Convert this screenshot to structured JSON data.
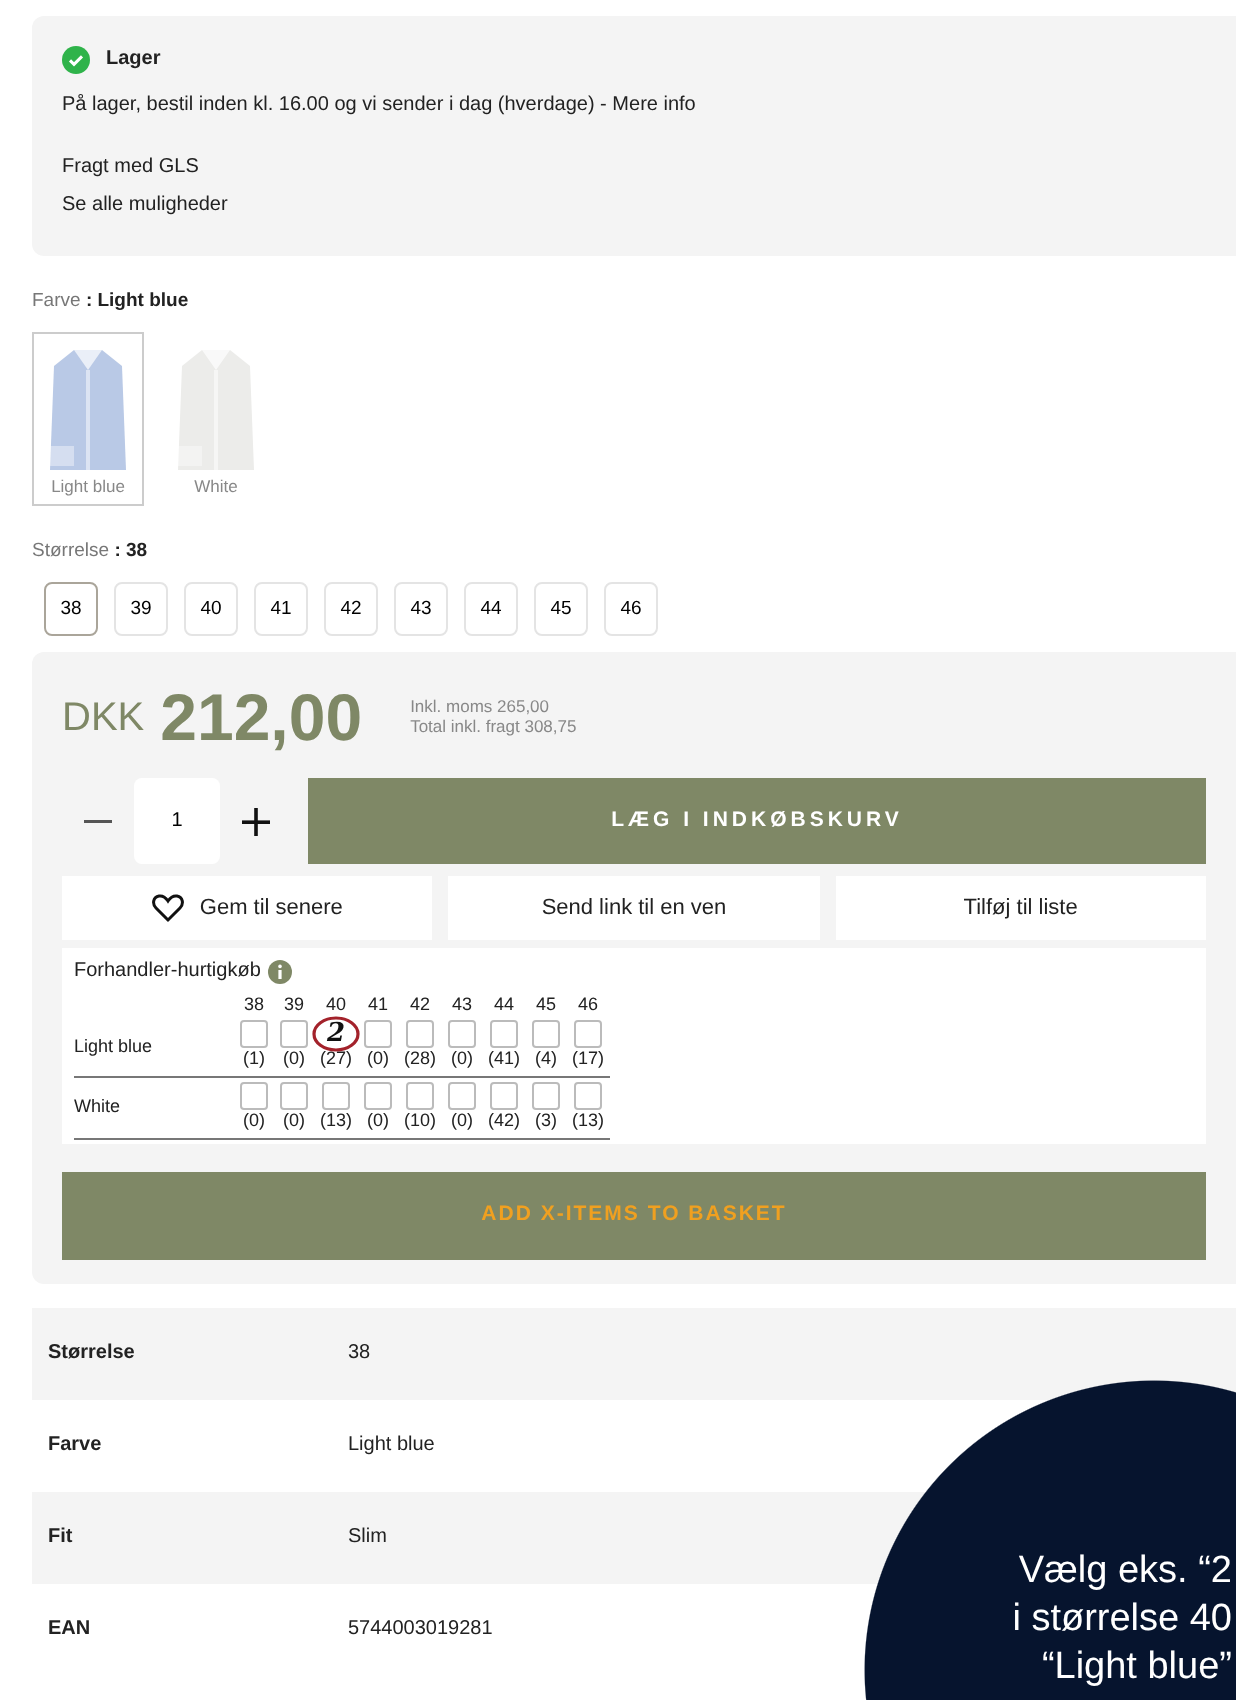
{
  "stock": {
    "title": "Lager",
    "message": "På lager, bestil inden kl. 16.00 og vi sender i dag (hverdage) - ",
    "more_link": "Mere info",
    "shipping": "Fragt med GLS",
    "options_link": "Se alle muligheder"
  },
  "color": {
    "label": "Farve",
    "value": ": Light blue",
    "swatches": [
      {
        "label": "Light blue",
        "selected": true
      },
      {
        "label": "White",
        "selected": false
      }
    ]
  },
  "size": {
    "label": "Størrelse",
    "value": ": 38",
    "options": [
      {
        "label": "38",
        "selected": true
      },
      {
        "label": "39",
        "selected": false
      },
      {
        "label": "40",
        "selected": false
      },
      {
        "label": "41",
        "selected": false
      },
      {
        "label": "42",
        "selected": false
      },
      {
        "label": "43",
        "selected": false
      },
      {
        "label": "44",
        "selected": false
      },
      {
        "label": "45",
        "selected": false
      },
      {
        "label": "46",
        "selected": false
      }
    ]
  },
  "price": {
    "currency": "DKK",
    "amount": "212,00",
    "vat": "Inkl. moms 265,00",
    "total": "Total inkl. fragt 308,75"
  },
  "quantity": {
    "value": "1"
  },
  "add_button": "LÆG I INDKØBSKURV",
  "actions": [
    {
      "label": "Gem til senere"
    },
    {
      "label": "Send link til en ven"
    },
    {
      "label": "Tilføj til liste"
    }
  ],
  "quick_buy": {
    "title": "Forhandler-hurtigkøb",
    "sizes": [
      "38",
      "39",
      "40",
      "41",
      "42",
      "43",
      "44",
      "45",
      "46"
    ],
    "rows": [
      {
        "label": "Light blue",
        "cells": [
          {
            "count": "(1)",
            "checked": false
          },
          {
            "count": "(0)",
            "checked": false
          },
          {
            "count": "(27)",
            "entered": "2"
          },
          {
            "count": "(0)",
            "checked": false
          },
          {
            "count": "(28)",
            "checked": false
          },
          {
            "count": "(0)",
            "checked": false
          },
          {
            "count": "(41)",
            "checked": false
          },
          {
            "count": "(4)",
            "checked": false
          },
          {
            "count": "(17)",
            "checked": false
          }
        ]
      },
      {
        "label": "White",
        "cells": [
          {
            "count": "(0)",
            "checked": false
          },
          {
            "count": "(0)",
            "checked": false
          },
          {
            "count": "(13)",
            "checked": false
          },
          {
            "count": "(0)",
            "checked": false
          },
          {
            "count": "(10)",
            "checked": false
          },
          {
            "count": "(0)",
            "checked": false
          },
          {
            "count": "(42)",
            "checked": false
          },
          {
            "count": "(3)",
            "checked": false
          },
          {
            "count": "(13)",
            "checked": false
          }
        ]
      }
    ],
    "button": "ADD X-ITEMS TO BASKET"
  },
  "specs": [
    {
      "label": "Størrelse",
      "value": "38"
    },
    {
      "label": "Farve",
      "value": "Light blue"
    },
    {
      "label": "Fit",
      "value": "Slim"
    },
    {
      "label": "EAN",
      "value": "5744003019281"
    }
  ],
  "callout": [
    "Vælg eks. “2",
    "i størrelse 40",
    "“Light blue”"
  ]
}
